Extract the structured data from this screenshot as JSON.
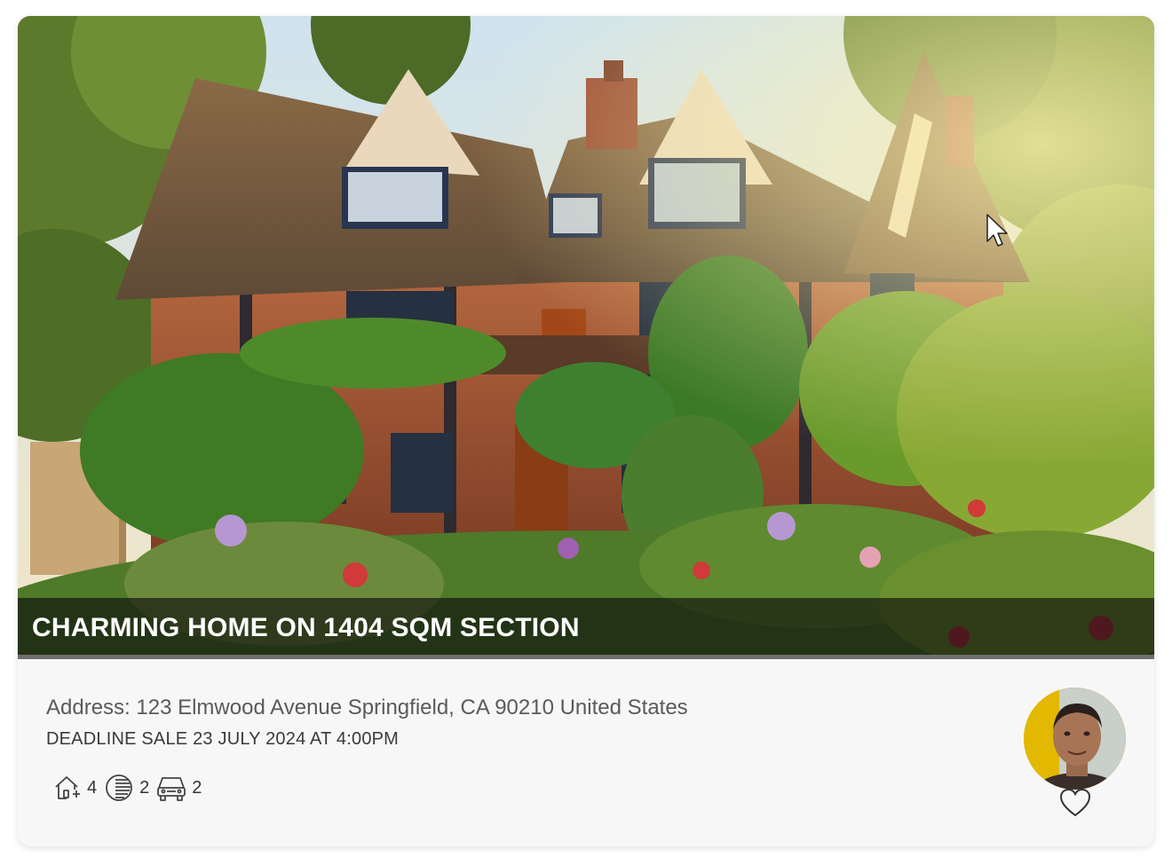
{
  "listing": {
    "title": "CHARMING HOME ON 1404 SQM SECTION",
    "address": "Address: 123 Elmwood Avenue Springfield, CA 90210 United States",
    "deadline": "DEADLINE SALE 23 JULY 2024 AT 4:00PM",
    "features": {
      "bedrooms": "4",
      "bathrooms": "2",
      "parking": "2"
    },
    "icons": {
      "bedrooms": "house-plus-icon",
      "bathrooms": "bath-icon",
      "parking": "car-icon",
      "favorite": "heart-icon"
    }
  },
  "colors": {
    "title_overlay": "#0a0a0a",
    "title_text": "#ffffff",
    "card_bg": "#f7f7f7",
    "avatar_bg": "#e2b800"
  }
}
